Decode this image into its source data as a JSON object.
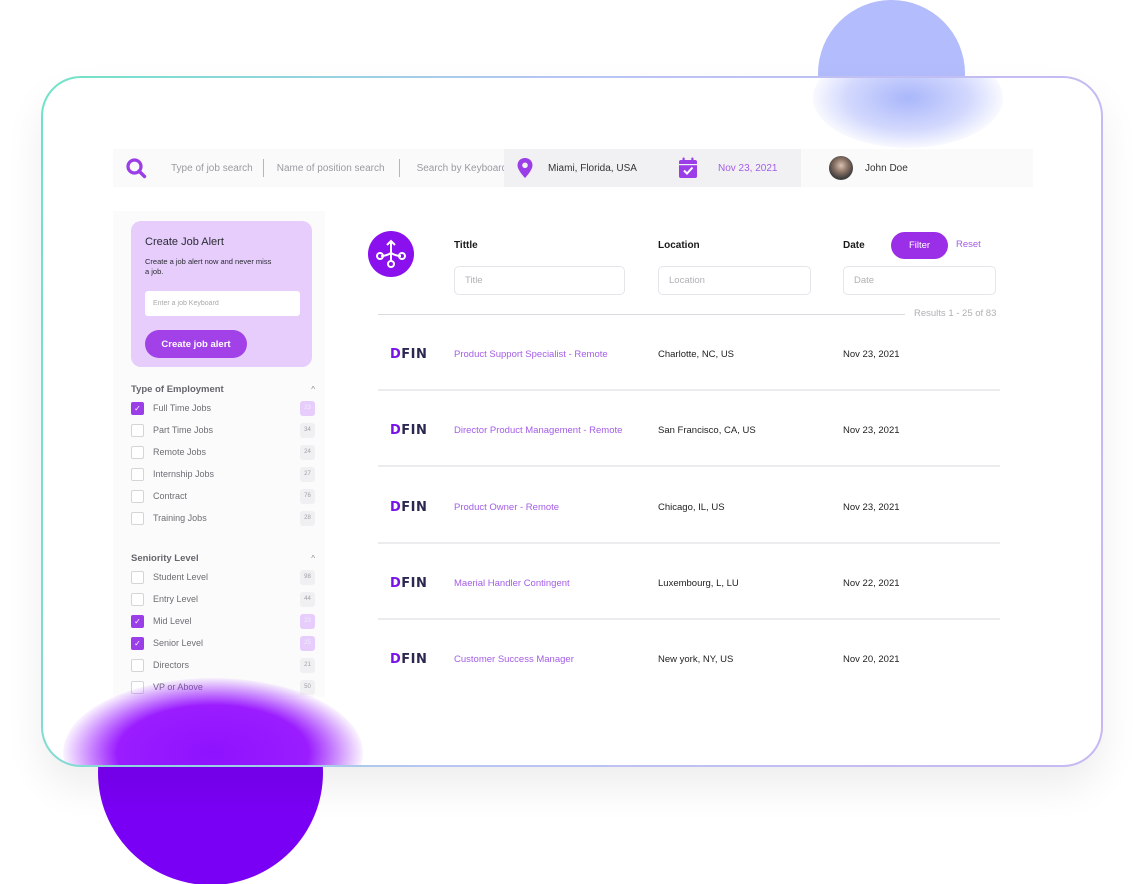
{
  "search": {
    "fields": [
      "Type of job search",
      "Name of position search",
      "Search by Keyboard"
    ],
    "location": "Miami, Florida, USA",
    "date": "Nov 23, 2021",
    "user_name": "John Doe"
  },
  "alert": {
    "title": "Create Job Alert",
    "description": "Create a job alert now and never miss a job.",
    "input_placeholder": "Enter a job Keyboard",
    "button_label": "Create job alert"
  },
  "employment": {
    "title": "Type of Employment",
    "options": [
      {
        "label": "Full Time Jobs",
        "count": "23",
        "checked": true
      },
      {
        "label": "Part Time Jobs",
        "count": "34",
        "checked": false
      },
      {
        "label": "Remote Jobs",
        "count": "24",
        "checked": false
      },
      {
        "label": "Internship Jobs",
        "count": "27",
        "checked": false
      },
      {
        "label": "Contract",
        "count": "76",
        "checked": false
      },
      {
        "label": "Training Jobs",
        "count": "28",
        "checked": false
      }
    ]
  },
  "seniority": {
    "title": "Seniority Level",
    "options": [
      {
        "label": "Student Level",
        "count": "98",
        "checked": false
      },
      {
        "label": "Entry Level",
        "count": "44",
        "checked": false
      },
      {
        "label": "Mid Level",
        "count": "23",
        "checked": true
      },
      {
        "label": "Senior Level",
        "count": "25",
        "checked": true
      },
      {
        "label": "Directors",
        "count": "21",
        "checked": false
      },
      {
        "label": "VP or Above",
        "count": "50",
        "checked": false
      }
    ]
  },
  "filters": {
    "title_label": "Tittle",
    "title_placeholder": "Title",
    "location_label": "Location",
    "location_placeholder": "Location",
    "date_label": "Date",
    "date_placeholder": "Date",
    "filter_button": "Filter",
    "reset_link": "Reset",
    "results": "Results 1 - 25 of 83"
  },
  "jobs": [
    {
      "company": "DFIN",
      "title": "Product Support Specialist - Remote",
      "location": "Charlotte, NC, US",
      "date": "Nov 23, 2021"
    },
    {
      "company": "DFIN",
      "title": "Director Product Management  - Remote",
      "location": "San Francisco, CA, US",
      "date": "Nov 23, 2021"
    },
    {
      "company": "DFIN",
      "title": "Product Owner - Remote",
      "location": "Chicago, IL, US",
      "date": "Nov 23, 2021"
    },
    {
      "company": "DFIN",
      "title": "Maerial Handler Contingent",
      "location": "Luxembourg, L, LU",
      "date": "Nov 22, 2021"
    },
    {
      "company": "DFIN",
      "title": "Customer Success Manager",
      "location": "New york, NY, US",
      "date": "Nov 20, 2021"
    }
  ],
  "colors": {
    "accent": "#9b2fe8",
    "accent_light": "#e6cdfc",
    "link": "#a45de6",
    "deco_top": "#b3bcfc",
    "deco_bottom": "#7a00f5"
  }
}
